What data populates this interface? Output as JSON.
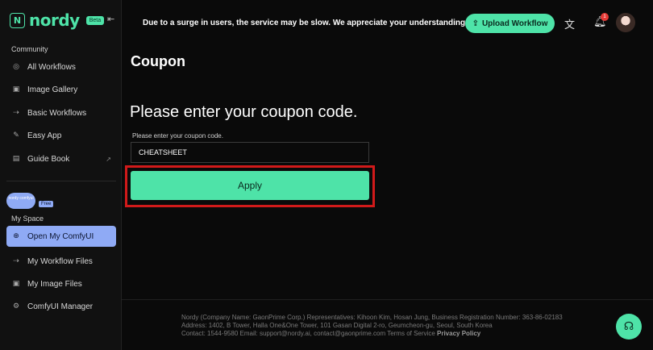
{
  "brand": {
    "name": "nordy",
    "logo_letter": "N",
    "badge": "Beta"
  },
  "sidebar": {
    "community_label": "Community",
    "community": [
      {
        "label": "All Workflows",
        "icon": "globe-icon"
      },
      {
        "label": "Image Gallery",
        "icon": "image-icon"
      },
      {
        "label": "Basic Workflows",
        "icon": "arrow-flow-icon"
      },
      {
        "label": "Easy App",
        "icon": "edit-icon"
      },
      {
        "label": "Guide Book",
        "icon": "book-icon"
      }
    ],
    "cloud_text": "nordy comfyui",
    "free_badge": "Free",
    "myspace_label": "My Space",
    "myspace": [
      {
        "label": "Open My ComfyUI",
        "icon": "plus-circle-icon"
      },
      {
        "label": "My Workflow Files",
        "icon": "arrow-flow-icon"
      },
      {
        "label": "My Image Files",
        "icon": "image-icon"
      },
      {
        "label": "ComfyUI Manager",
        "icon": "gear-icon"
      }
    ]
  },
  "header": {
    "notice": "Due to a surge in users, the service may be slow. We appreciate your understanding.",
    "upload_label": "Upload Workflow",
    "notification_count": "1"
  },
  "main": {
    "title": "Coupon",
    "heading": "Please enter your coupon code.",
    "field_label": "Please enter your coupon code.",
    "coupon_value": "CHEATSHEET",
    "apply_label": "Apply"
  },
  "footer": {
    "line1": "Nordy (Company Name: GaonPrime Corp.) Representatives: Kihoon Kim, Hosan Jung, Business Registration Number: 363-86-02183",
    "line2": "Address: 1402, B Tower, Halla One&One Tower, 101 Gasan Digital 2-ro, Geumcheon-gu, Seoul, South Korea",
    "line3": "Contact: 1544-9580 Email: support@nordy.ai, contact@gaonprime.com Terms of Service",
    "privacy": "Privacy Policy"
  },
  "colors": {
    "accent": "#4ee3a8",
    "active_nav": "#8faaf5",
    "highlight": "#d11a1a"
  }
}
